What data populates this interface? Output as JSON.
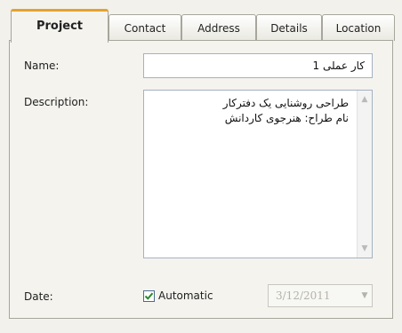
{
  "tabs": [
    {
      "label": "Project",
      "active": true
    },
    {
      "label": "Contact",
      "active": false
    },
    {
      "label": "Address",
      "active": false
    },
    {
      "label": "Details",
      "active": false
    },
    {
      "label": "Location",
      "active": false
    }
  ],
  "form": {
    "name_label": "Name:",
    "name_value": "کار عملی 1",
    "description_label": "Description:",
    "description_value": "طراحی روشنایی یک دفترکار\nنام طراح: هنرجوی کاردانش",
    "date_label": "Date:",
    "automatic_label": "Automatic",
    "automatic_checked": true,
    "check_mark": "✓",
    "date_value": "3/12/2011"
  },
  "colors": {
    "active_tab_accent": "#e6a22c",
    "checkmark": "#2a8a2a"
  },
  "icons": {
    "scroll_up": "scroll-up-arrow-icon",
    "scroll_down": "scroll-down-arrow-icon",
    "date_dropdown": "chevron-down-icon"
  }
}
